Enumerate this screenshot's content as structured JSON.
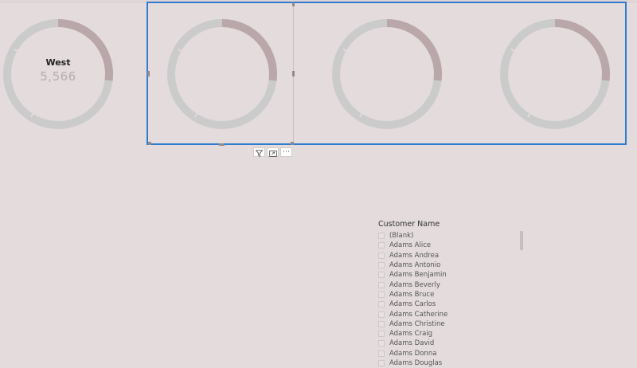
{
  "donuts": [
    {
      "label": "West",
      "value": "5,566"
    },
    {
      "label": "",
      "value": ""
    },
    {
      "label": "",
      "value": ""
    },
    {
      "label": "",
      "value": ""
    }
  ],
  "colors": {
    "background": "#e3dbdc",
    "ring_base": "#cbcbcb",
    "ring_highlight": "#b9a7a9",
    "selection": "#2f7bd0"
  },
  "toolbar": {
    "filter_icon": "filter-icon",
    "focus_icon": "focus-mode-icon",
    "more_label": "⋯"
  },
  "slicer": {
    "title": "Customer Name",
    "items": [
      "(Blank)",
      "Adams Alice",
      "Adams Andrea",
      "Adams Antonio",
      "Adams Benjamin",
      "Adams Beverly",
      "Adams Bruce",
      "Adams Carlos",
      "Adams Catherine",
      "Adams Christine",
      "Adams Craig",
      "Adams David",
      "Adams Donna",
      "Adams Douglas"
    ]
  }
}
